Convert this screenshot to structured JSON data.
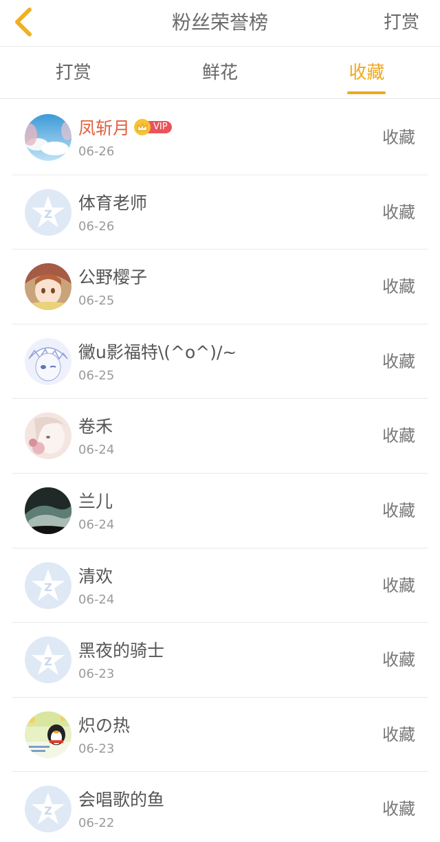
{
  "header": {
    "back_icon": "chevron-left-icon",
    "title": "粉丝荣誉榜",
    "action": "打赏",
    "accent": "#f0a81f"
  },
  "tabs": [
    {
      "label": "打赏",
      "active": false
    },
    {
      "label": "鲜花",
      "active": false
    },
    {
      "label": "收藏",
      "active": true
    }
  ],
  "list": [
    {
      "name": "凤斩月",
      "date": "06-26",
      "action": "收藏",
      "vip": true,
      "vip_label": "VIP",
      "avatar": "sky-avatar"
    },
    {
      "name": "体育老师",
      "date": "06-26",
      "action": "收藏",
      "vip": false,
      "avatar": "default-avatar"
    },
    {
      "name": "公野樱子",
      "date": "06-25",
      "action": "收藏",
      "vip": false,
      "avatar": "anime-girl-avatar"
    },
    {
      "name": "黴u影福特\\(^o^)/~",
      "date": "06-25",
      "action": "收藏",
      "vip": false,
      "avatar": "anime-boy-avatar"
    },
    {
      "name": "卷禾",
      "date": "06-24",
      "action": "收藏",
      "vip": false,
      "avatar": "sketch-girl-avatar"
    },
    {
      "name": "兰儿",
      "date": "06-24",
      "action": "收藏",
      "vip": false,
      "avatar": "dark-scene-avatar"
    },
    {
      "name": "清欢",
      "date": "06-24",
      "action": "收藏",
      "vip": false,
      "avatar": "default-avatar"
    },
    {
      "name": "黑夜的骑士",
      "date": "06-23",
      "action": "收藏",
      "vip": false,
      "avatar": "default-avatar"
    },
    {
      "name": "炽の热",
      "date": "06-23",
      "action": "收藏",
      "vip": false,
      "avatar": "penguin-avatar"
    },
    {
      "name": "会唱歌的鱼",
      "date": "06-22",
      "action": "收藏",
      "vip": false,
      "avatar": "default-avatar"
    }
  ]
}
